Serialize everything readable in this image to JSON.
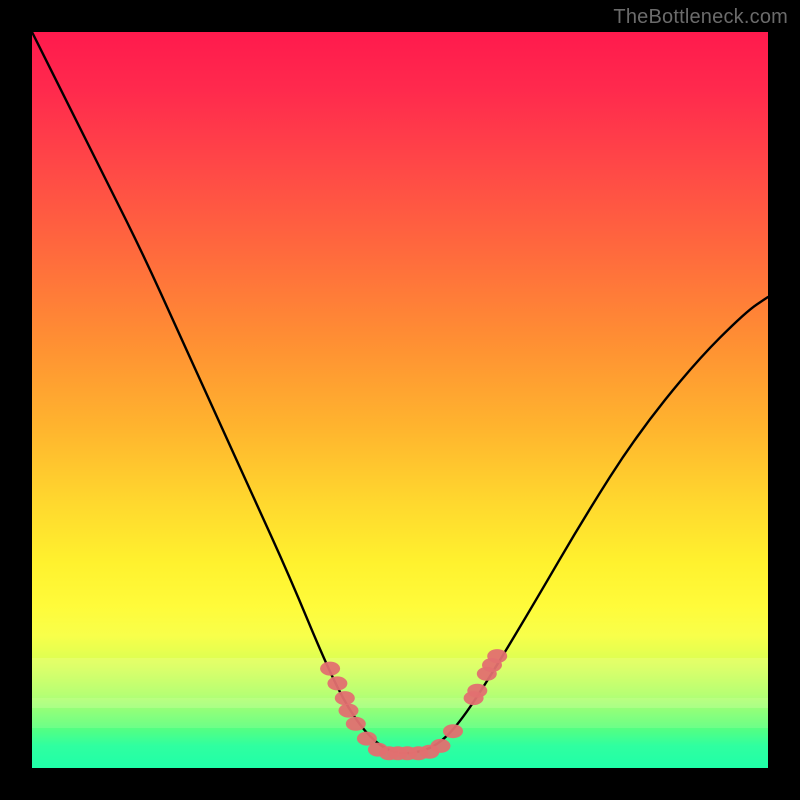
{
  "watermark": "TheBottleneck.com",
  "chart_data": {
    "type": "line",
    "title": "",
    "xlabel": "",
    "ylabel": "",
    "xlim": [
      0,
      1
    ],
    "ylim": [
      0,
      1
    ],
    "series": [
      {
        "name": "bottleneck-curve",
        "x": [
          0.0,
          0.05,
          0.1,
          0.15,
          0.2,
          0.25,
          0.3,
          0.35,
          0.4,
          0.43,
          0.46,
          0.49,
          0.52,
          0.55,
          0.58,
          0.62,
          0.68,
          0.75,
          0.82,
          0.9,
          0.97,
          1.0
        ],
        "y": [
          1.0,
          0.9,
          0.8,
          0.7,
          0.59,
          0.48,
          0.37,
          0.26,
          0.14,
          0.08,
          0.04,
          0.02,
          0.02,
          0.03,
          0.06,
          0.12,
          0.22,
          0.34,
          0.45,
          0.55,
          0.62,
          0.64
        ]
      }
    ],
    "markers": {
      "name": "highlight-dots",
      "color": "#e27070",
      "points": [
        {
          "x": 0.405,
          "y": 0.135
        },
        {
          "x": 0.415,
          "y": 0.115
        },
        {
          "x": 0.425,
          "y": 0.095
        },
        {
          "x": 0.43,
          "y": 0.078
        },
        {
          "x": 0.44,
          "y": 0.06
        },
        {
          "x": 0.455,
          "y": 0.04
        },
        {
          "x": 0.47,
          "y": 0.025
        },
        {
          "x": 0.485,
          "y": 0.02
        },
        {
          "x": 0.497,
          "y": 0.02
        },
        {
          "x": 0.51,
          "y": 0.02
        },
        {
          "x": 0.525,
          "y": 0.02
        },
        {
          "x": 0.54,
          "y": 0.022
        },
        {
          "x": 0.555,
          "y": 0.03
        },
        {
          "x": 0.572,
          "y": 0.05
        },
        {
          "x": 0.6,
          "y": 0.095
        },
        {
          "x": 0.605,
          "y": 0.105
        },
        {
          "x": 0.618,
          "y": 0.128
        },
        {
          "x": 0.625,
          "y": 0.14
        },
        {
          "x": 0.632,
          "y": 0.152
        }
      ]
    },
    "gradient_stops": [
      {
        "pos": 0.0,
        "color": "#ff1a4d"
      },
      {
        "pos": 0.5,
        "color": "#ffb52e"
      },
      {
        "pos": 0.78,
        "color": "#fffb3a"
      },
      {
        "pos": 1.0,
        "color": "#1fffa8"
      }
    ]
  }
}
